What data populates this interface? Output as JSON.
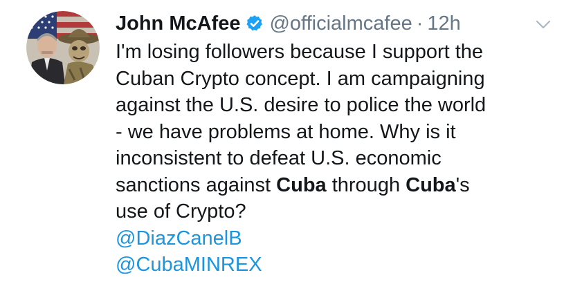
{
  "tweet": {
    "author_name": "John McAfee",
    "handle": "@officialmcafee",
    "separator": "·",
    "time": "12h",
    "icons": {
      "verified": "verified-badge-icon",
      "menu": "chevron-down-icon"
    },
    "colors": {
      "text": "#14171a",
      "secondary": "#657786",
      "link": "#1b95e0",
      "verified": "#1da1f2"
    },
    "lines": [
      "I'm losing followers because I support the",
      "Cuban Crypto concept. I am campaigning",
      "against the U.S. desire to police the world",
      "- we have problems at home. Why is it",
      "inconsistent to defeat U.S. economic"
    ],
    "line6": {
      "part1": "sanctions against ",
      "bold1": "Cuba",
      "part2": " through ",
      "bold2": "Cuba",
      "part3": "'s"
    },
    "line7": "use of Crypto?",
    "mentions": [
      "@DiazCanelB",
      "@CubaMINREX"
    ]
  }
}
